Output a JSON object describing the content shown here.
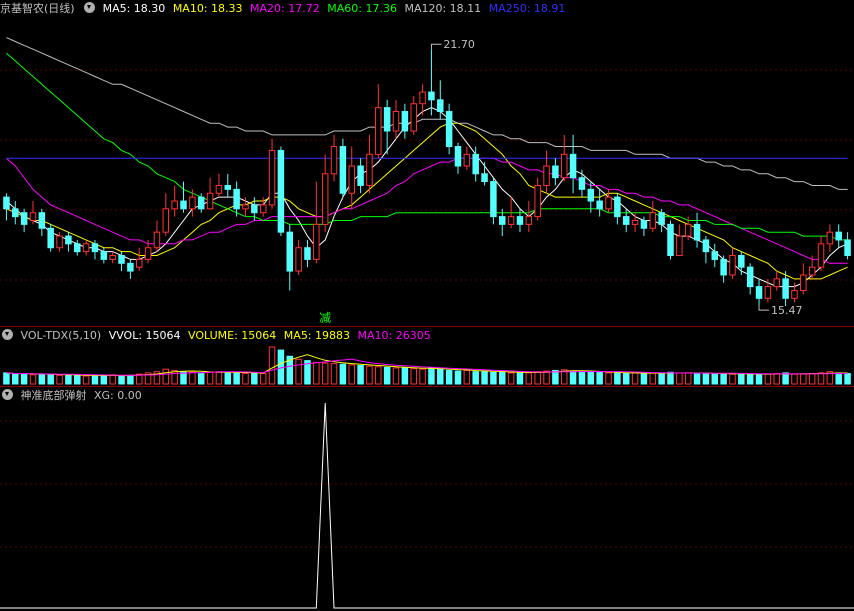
{
  "main": {
    "title": "京基智农(日线)",
    "ma5": "MA5: 18.30",
    "ma10": "MA10: 18.33",
    "ma20": "MA20: 17.72",
    "ma60": "MA60: 17.36",
    "ma120": "MA120: 18.11",
    "ma250": "MA250: 18.91",
    "high_label": "21.70",
    "low_label": "15.47",
    "marker": "减"
  },
  "volume": {
    "title": "VOL-TDX(5,10)",
    "vvol": "VVOL: 15064",
    "vol": "VOLUME: 15064",
    "ma5": "MA5: 19883",
    "ma10": "MA10: 26305"
  },
  "indicator": {
    "title": "神准底部弹射",
    "xg": "XG: 0.00"
  },
  "colors": {
    "up": "#ff3232",
    "down": "#54ffff",
    "ma5": "#ffffff",
    "ma10": "#ffff00",
    "ma20": "#ff00ff",
    "ma60": "#00ff00",
    "ma120": "#c0c0c0",
    "ma250": "#3030ff"
  },
  "chart_data": {
    "type": "candlestick",
    "ylim": [
      15.0,
      22.4
    ],
    "candles": [
      [
        17.9,
        17.6,
        18.0,
        17.3
      ],
      [
        17.6,
        17.4,
        17.8,
        17.2
      ],
      [
        17.5,
        17.2,
        17.6,
        17.0
      ],
      [
        17.3,
        17.5,
        17.8,
        17.2
      ],
      [
        17.5,
        17.1,
        17.6,
        16.9
      ],
      [
        17.1,
        16.6,
        17.2,
        16.5
      ],
      [
        16.6,
        16.9,
        17.0,
        16.5
      ],
      [
        16.9,
        16.7,
        17.0,
        16.5
      ],
      [
        16.7,
        16.5,
        16.8,
        16.4
      ],
      [
        16.5,
        16.7,
        16.8,
        16.4
      ],
      [
        16.7,
        16.5,
        16.8,
        16.3
      ],
      [
        16.5,
        16.3,
        16.6,
        16.2
      ],
      [
        16.3,
        16.4,
        16.5,
        16.2
      ],
      [
        16.4,
        16.2,
        16.5,
        16.0
      ],
      [
        16.2,
        16.0,
        16.3,
        15.8
      ],
      [
        16.1,
        16.3,
        16.6,
        16.0
      ],
      [
        16.3,
        16.6,
        16.8,
        16.2
      ],
      [
        16.6,
        17.0,
        17.3,
        16.5
      ],
      [
        17.0,
        17.6,
        18.0,
        16.9
      ],
      [
        17.6,
        17.8,
        18.2,
        17.4
      ],
      [
        17.8,
        17.6,
        18.3,
        17.5
      ],
      [
        17.6,
        17.9,
        18.1,
        17.4
      ],
      [
        17.9,
        17.6,
        18.0,
        17.5
      ],
      [
        17.6,
        18.0,
        18.4,
        17.6
      ],
      [
        18.0,
        18.2,
        18.5,
        17.9
      ],
      [
        18.2,
        18.1,
        18.5,
        17.9
      ],
      [
        18.1,
        17.6,
        18.3,
        17.4
      ],
      [
        17.6,
        17.7,
        17.9,
        17.4
      ],
      [
        17.7,
        17.5,
        17.9,
        17.3
      ],
      [
        17.5,
        17.7,
        17.9,
        17.4
      ],
      [
        17.7,
        19.1,
        19.4,
        17.6
      ],
      [
        19.1,
        17.0,
        19.2,
        16.9
      ],
      [
        17.0,
        16.0,
        17.2,
        15.5
      ],
      [
        16.0,
        16.6,
        16.8,
        15.9
      ],
      [
        16.6,
        16.3,
        16.8,
        16.1
      ],
      [
        16.3,
        17.2,
        18.3,
        16.2
      ],
      [
        17.2,
        18.5,
        19.0,
        17.0
      ],
      [
        18.5,
        19.2,
        19.5,
        18.3
      ],
      [
        19.2,
        18.0,
        19.4,
        17.9
      ],
      [
        18.0,
        18.7,
        19.2,
        17.6
      ],
      [
        18.7,
        18.2,
        18.9,
        18.0
      ],
      [
        18.2,
        19.0,
        19.5,
        18.0
      ],
      [
        19.0,
        20.2,
        20.8,
        18.9
      ],
      [
        20.2,
        19.6,
        20.4,
        19.0
      ],
      [
        19.6,
        20.1,
        20.4,
        19.4
      ],
      [
        20.1,
        19.6,
        20.3,
        19.4
      ],
      [
        19.6,
        20.3,
        20.5,
        19.5
      ],
      [
        20.3,
        20.6,
        20.8,
        20.0
      ],
      [
        20.6,
        20.4,
        21.7,
        20.0
      ],
      [
        20.4,
        20.1,
        20.9,
        19.9
      ],
      [
        20.1,
        19.2,
        20.3,
        19.0
      ],
      [
        19.2,
        18.7,
        19.3,
        18.5
      ],
      [
        18.7,
        19.0,
        19.2,
        18.6
      ],
      [
        19.0,
        18.5,
        19.2,
        18.3
      ],
      [
        18.5,
        18.3,
        18.8,
        18.2
      ],
      [
        18.3,
        17.4,
        18.4,
        17.2
      ],
      [
        17.4,
        17.2,
        17.6,
        16.9
      ],
      [
        17.2,
        17.4,
        17.9,
        17.1
      ],
      [
        17.4,
        17.2,
        17.6,
        17.0
      ],
      [
        17.2,
        17.4,
        17.8,
        17.0
      ],
      [
        17.4,
        18.2,
        18.4,
        17.3
      ],
      [
        18.2,
        18.7,
        19.1,
        18.0
      ],
      [
        18.7,
        18.4,
        18.9,
        18.2
      ],
      [
        18.4,
        19.0,
        19.5,
        18.3
      ],
      [
        19.0,
        18.4,
        19.5,
        18.0
      ],
      [
        18.4,
        18.1,
        18.6,
        17.9
      ],
      [
        18.1,
        17.8,
        18.3,
        17.5
      ],
      [
        17.8,
        17.6,
        18.1,
        17.4
      ],
      [
        17.6,
        17.9,
        18.1,
        17.5
      ],
      [
        17.9,
        17.4,
        18.0,
        17.2
      ],
      [
        17.4,
        17.2,
        17.6,
        17.0
      ],
      [
        17.2,
        17.3,
        17.5,
        17.0
      ],
      [
        17.3,
        17.1,
        17.4,
        16.9
      ],
      [
        17.1,
        17.5,
        17.8,
        17.0
      ],
      [
        17.5,
        17.2,
        17.6,
        17.0
      ],
      [
        17.2,
        16.4,
        17.3,
        16.3
      ],
      [
        16.4,
        16.9,
        17.2,
        16.4
      ],
      [
        16.9,
        17.2,
        17.4,
        16.8
      ],
      [
        17.2,
        16.8,
        17.5,
        16.6
      ],
      [
        16.8,
        16.5,
        16.9,
        16.2
      ],
      [
        16.5,
        16.3,
        16.7,
        16.1
      ],
      [
        16.3,
        15.9,
        16.4,
        15.7
      ],
      [
        15.9,
        16.4,
        16.6,
        15.8
      ],
      [
        16.4,
        16.1,
        16.5,
        15.9
      ],
      [
        16.1,
        15.6,
        16.2,
        15.4
      ],
      [
        15.6,
        15.3,
        15.8,
        15.1
      ],
      [
        15.3,
        15.6,
        15.8,
        15.2
      ],
      [
        15.6,
        15.8,
        16.0,
        15.5
      ],
      [
        15.8,
        15.3,
        16.0,
        15.1
      ],
      [
        15.3,
        15.5,
        15.7,
        15.2
      ],
      [
        15.5,
        15.9,
        16.2,
        15.4
      ],
      [
        15.9,
        16.1,
        16.4,
        15.8
      ],
      [
        16.1,
        16.7,
        16.9,
        16.0
      ],
      [
        16.7,
        17.0,
        17.2,
        16.5
      ],
      [
        17.0,
        16.8,
        17.2,
        16.6
      ],
      [
        16.8,
        16.4,
        17.0,
        16.3
      ]
    ],
    "ma_lines": [
      {
        "name": "MA5",
        "values": [
          17.8,
          17.6,
          17.4,
          17.3,
          17.2,
          17.0,
          16.9,
          16.8,
          16.7,
          16.6,
          16.6,
          16.5,
          16.5,
          16.4,
          16.3,
          16.3,
          16.4,
          16.5,
          16.7,
          17.0,
          17.3,
          17.6,
          17.7,
          17.8,
          17.9,
          17.9,
          17.9,
          17.8,
          17.7,
          17.7,
          18.0,
          18.0,
          17.6,
          17.3,
          16.9,
          16.6,
          16.8,
          17.4,
          17.9,
          18.3,
          18.5,
          18.6,
          18.8,
          19.1,
          19.4,
          19.7,
          19.9,
          20.1,
          20.2,
          20.1,
          19.9,
          19.6,
          19.3,
          19.0,
          18.7,
          18.4,
          18.1,
          17.9,
          17.6,
          17.4,
          17.6,
          17.9,
          18.1,
          18.4,
          18.6,
          18.5,
          18.3,
          18.1,
          17.9,
          17.8,
          17.6,
          17.4,
          17.3,
          17.3,
          17.2,
          17.0,
          16.9,
          16.9,
          16.8,
          16.7,
          16.5,
          16.3,
          16.2,
          16.0,
          15.9,
          15.8,
          15.7,
          15.6,
          15.6,
          15.6,
          15.7,
          15.9,
          16.1,
          16.4,
          16.6,
          16.7
        ]
      },
      {
        "name": "MA10",
        "values": [
          17.6,
          17.5,
          17.4,
          17.3,
          17.3,
          17.2,
          17.1,
          17.0,
          16.9,
          16.8,
          16.7,
          16.6,
          16.6,
          16.5,
          16.5,
          16.4,
          16.4,
          16.4,
          16.5,
          16.6,
          16.8,
          17.0,
          17.2,
          17.3,
          17.5,
          17.6,
          17.7,
          17.7,
          17.8,
          17.8,
          17.9,
          17.9,
          17.8,
          17.6,
          17.5,
          17.4,
          17.4,
          17.5,
          17.6,
          17.7,
          17.9,
          18.1,
          18.3,
          18.5,
          18.7,
          18.9,
          19.1,
          19.3,
          19.5,
          19.7,
          19.8,
          19.8,
          19.7,
          19.6,
          19.4,
          19.2,
          19.0,
          18.7,
          18.5,
          18.2,
          18.1,
          18.0,
          17.9,
          17.9,
          17.9,
          17.9,
          17.9,
          17.9,
          18.0,
          18.0,
          17.9,
          17.8,
          17.7,
          17.6,
          17.5,
          17.4,
          17.3,
          17.2,
          17.1,
          17.0,
          16.9,
          16.8,
          16.6,
          16.5,
          16.4,
          16.3,
          16.2,
          16.0,
          15.9,
          15.8,
          15.8,
          15.8,
          15.8,
          15.9,
          16.0,
          16.1
        ]
      },
      {
        "name": "MA20",
        "values": [
          18.9,
          18.7,
          18.4,
          18.1,
          17.9,
          17.7,
          17.6,
          17.5,
          17.4,
          17.3,
          17.2,
          17.1,
          17.0,
          16.9,
          16.8,
          16.8,
          16.7,
          16.7,
          16.7,
          16.7,
          16.8,
          16.8,
          16.9,
          17.0,
          17.0,
          17.1,
          17.2,
          17.2,
          17.3,
          17.3,
          17.4,
          17.4,
          17.4,
          17.4,
          17.4,
          17.4,
          17.4,
          17.5,
          17.6,
          17.6,
          17.7,
          17.8,
          17.9,
          18.0,
          18.2,
          18.3,
          18.5,
          18.6,
          18.7,
          18.8,
          18.8,
          18.9,
          18.9,
          18.9,
          18.9,
          18.9,
          18.8,
          18.8,
          18.7,
          18.6,
          18.6,
          18.5,
          18.5,
          18.4,
          18.4,
          18.3,
          18.2,
          18.2,
          18.1,
          18.1,
          18.0,
          18.0,
          17.9,
          17.9,
          17.8,
          17.8,
          17.7,
          17.7,
          17.6,
          17.5,
          17.4,
          17.3,
          17.2,
          17.1,
          17.0,
          16.9,
          16.8,
          16.7,
          16.6,
          16.5,
          16.4,
          16.3,
          16.3,
          16.2,
          16.2,
          16.2
        ]
      },
      {
        "name": "MA60",
        "values": [
          21.6,
          21.4,
          21.2,
          21.0,
          20.8,
          20.6,
          20.4,
          20.2,
          20.0,
          19.8,
          19.6,
          19.4,
          19.3,
          19.1,
          19.0,
          18.8,
          18.7,
          18.5,
          18.4,
          18.3,
          18.1,
          18.0,
          17.9,
          17.8,
          17.7,
          17.6,
          17.5,
          17.4,
          17.4,
          17.3,
          17.3,
          17.3,
          17.2,
          17.2,
          17.2,
          17.2,
          17.2,
          17.3,
          17.3,
          17.3,
          17.4,
          17.4,
          17.4,
          17.4,
          17.5,
          17.5,
          17.5,
          17.5,
          17.5,
          17.5,
          17.5,
          17.5,
          17.5,
          17.5,
          17.5,
          17.5,
          17.5,
          17.5,
          17.5,
          17.5,
          17.6,
          17.6,
          17.6,
          17.6,
          17.6,
          17.6,
          17.6,
          17.6,
          17.5,
          17.5,
          17.5,
          17.5,
          17.5,
          17.5,
          17.4,
          17.4,
          17.4,
          17.3,
          17.3,
          17.3,
          17.2,
          17.2,
          17.2,
          17.1,
          17.1,
          17.1,
          17.0,
          17.0,
          17.0,
          17.0,
          16.9,
          16.9,
          16.9,
          16.9,
          16.8,
          16.8
        ]
      },
      {
        "name": "MA120",
        "values": [
          22.0,
          21.9,
          21.8,
          21.7,
          21.6,
          21.5,
          21.4,
          21.3,
          21.2,
          21.1,
          21.0,
          20.9,
          20.8,
          20.8,
          20.7,
          20.6,
          20.5,
          20.4,
          20.3,
          20.2,
          20.1,
          20.0,
          19.9,
          19.8,
          19.8,
          19.7,
          19.7,
          19.6,
          19.6,
          19.6,
          19.5,
          19.5,
          19.5,
          19.5,
          19.5,
          19.5,
          19.5,
          19.6,
          19.6,
          19.6,
          19.6,
          19.7,
          19.7,
          19.7,
          19.8,
          19.8,
          19.8,
          19.9,
          19.9,
          19.9,
          19.9,
          19.8,
          19.8,
          19.7,
          19.6,
          19.5,
          19.5,
          19.4,
          19.4,
          19.3,
          19.3,
          19.3,
          19.2,
          19.2,
          19.2,
          19.2,
          19.1,
          19.1,
          19.1,
          19.1,
          19.1,
          19.0,
          19.0,
          19.0,
          19.0,
          18.9,
          18.9,
          18.9,
          18.9,
          18.8,
          18.8,
          18.7,
          18.7,
          18.6,
          18.6,
          18.5,
          18.5,
          18.4,
          18.4,
          18.3,
          18.3,
          18.2,
          18.2,
          18.2,
          18.1,
          18.1
        ]
      },
      {
        "name": "MA250",
        "values": [
          18.9,
          18.9,
          18.9,
          18.9,
          18.9,
          18.9,
          18.9,
          18.9,
          18.9,
          18.9,
          18.9,
          18.9,
          18.9,
          18.9,
          18.9,
          18.9,
          18.9,
          18.9,
          18.9,
          18.9,
          18.9,
          18.9,
          18.9,
          18.9,
          18.9,
          18.9,
          18.9,
          18.9,
          18.9,
          18.9,
          18.9,
          18.9,
          18.9,
          18.9,
          18.9,
          18.9,
          18.9,
          18.9,
          18.9,
          18.9,
          18.9,
          18.9,
          18.9,
          18.9,
          18.9,
          18.9,
          18.9,
          18.9,
          18.9,
          18.9,
          18.9,
          18.9,
          18.9,
          18.9,
          18.9,
          18.9,
          18.9,
          18.9,
          18.9,
          18.9,
          18.9,
          18.9,
          18.9,
          18.9,
          18.9,
          18.9,
          18.9,
          18.9,
          18.9,
          18.9,
          18.9,
          18.9,
          18.9,
          18.9,
          18.9,
          18.9,
          18.9,
          18.9,
          18.9,
          18.9,
          18.9,
          18.9,
          18.9,
          18.9,
          18.9,
          18.9,
          18.9,
          18.9,
          18.9,
          18.9,
          18.9,
          18.9,
          18.9,
          18.9,
          18.9,
          18.9
        ]
      }
    ],
    "volume_values": [
      18,
      16,
      17,
      15,
      16,
      15,
      14,
      15,
      14,
      13,
      14,
      14,
      15,
      13,
      14,
      16,
      18,
      20,
      24,
      22,
      20,
      19,
      18,
      19,
      20,
      19,
      18,
      17,
      18,
      17,
      60,
      55,
      45,
      40,
      38,
      35,
      34,
      33,
      32,
      31,
      30,
      29,
      28,
      27,
      26,
      26,
      25,
      24,
      26,
      24,
      22,
      21,
      22,
      20,
      21,
      19,
      19,
      18,
      19,
      18,
      20,
      21,
      22,
      23,
      21,
      20,
      19,
      19,
      18,
      18,
      17,
      18,
      17,
      18,
      17,
      19,
      18,
      18,
      17,
      17,
      16,
      17,
      16,
      17,
      16,
      15,
      16,
      17,
      18,
      16,
      16,
      17,
      18,
      20,
      18,
      17
    ],
    "xg_values": [
      0,
      0,
      0,
      0,
      0,
      0,
      0,
      0,
      0,
      0,
      0,
      0,
      0,
      0,
      0,
      0,
      0,
      0,
      0,
      0,
      0,
      0,
      0,
      0,
      0,
      0,
      0,
      0,
      0,
      0,
      0,
      0,
      0,
      0,
      0,
      0,
      1,
      0,
      0,
      0,
      0,
      0,
      0,
      0,
      0,
      0,
      0,
      0,
      0,
      0,
      0,
      0,
      0,
      0,
      0,
      0,
      0,
      0,
      0,
      0,
      0,
      0,
      0,
      0,
      0,
      0,
      0,
      0,
      0,
      0,
      0,
      0,
      0,
      0,
      0,
      0,
      0,
      0,
      0,
      0,
      0,
      0,
      0,
      0,
      0,
      0,
      0,
      0,
      0,
      0,
      0,
      0,
      0,
      0,
      0,
      0
    ]
  }
}
